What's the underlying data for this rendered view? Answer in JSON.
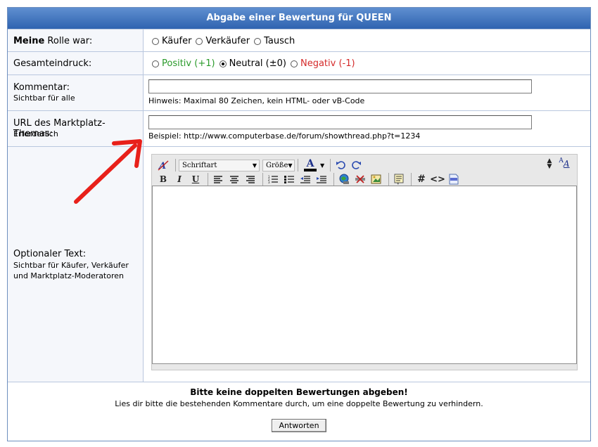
{
  "title": "Abgabe einer Bewertung für QUEEN",
  "role": {
    "label_bold": "Meine",
    "label_rest": " Rolle war:",
    "options": [
      "Käufer",
      "Verkäufer",
      "Tausch"
    ]
  },
  "impression": {
    "label": "Gesamteindruck:",
    "positive": "Positiv (+1)",
    "neutral": "Neutral (±0)",
    "negative": "Negativ (-1)",
    "selected": "neutral",
    "colors": {
      "positive": "#2a9a2a",
      "negative": "#d42a2a"
    }
  },
  "comment": {
    "label": "Kommentar:",
    "sub": "Sichtbar für alle",
    "value": "",
    "hint": "Hinweis: Maximal 80 Zeichen, kein HTML- oder vB-Code"
  },
  "url": {
    "label": "URL des Marktplatz-Themas:",
    "sub": "Erforderlich",
    "value": "",
    "hint": "Beispiel: http://www.computerbase.de/forum/showthread.php?t=1234"
  },
  "optional": {
    "label": "Optionaler Text:",
    "sub_line1": "Sichtbar für Käufer, Verkäufer",
    "sub_line2": "und Marktplatz-Moderatoren"
  },
  "editor": {
    "font_select": "Schriftart",
    "size_select": "Größe",
    "icons_row1": [
      "clear-formatting-icon",
      "font-color-icon",
      "undo-icon",
      "redo-icon",
      "resize-icon",
      "switch-mode-icon"
    ],
    "icons_row2": [
      "bold-icon",
      "italic-icon",
      "underline-icon",
      "align-left-icon",
      "align-center-icon",
      "align-right-icon",
      "ordered-list-icon",
      "unordered-list-icon",
      "outdent-icon",
      "indent-icon",
      "insert-link-icon",
      "remove-link-icon",
      "insert-image-icon",
      "quote-icon",
      "hash-icon",
      "code-icon",
      "php-icon"
    ],
    "bold": "B",
    "italic": "I",
    "underline": "U",
    "hash": "#",
    "code": "<>",
    "font_color_letter": "A",
    "switch_letters": "AA"
  },
  "footer": {
    "warning": "Bitte keine doppelten Bewertungen abgeben!",
    "note": "Lies dir bitte die bestehenden Kommentare durch, um eine doppelte Bewertung zu verhindern.",
    "submit": "Antworten"
  },
  "annotation_color": "#e8201a"
}
